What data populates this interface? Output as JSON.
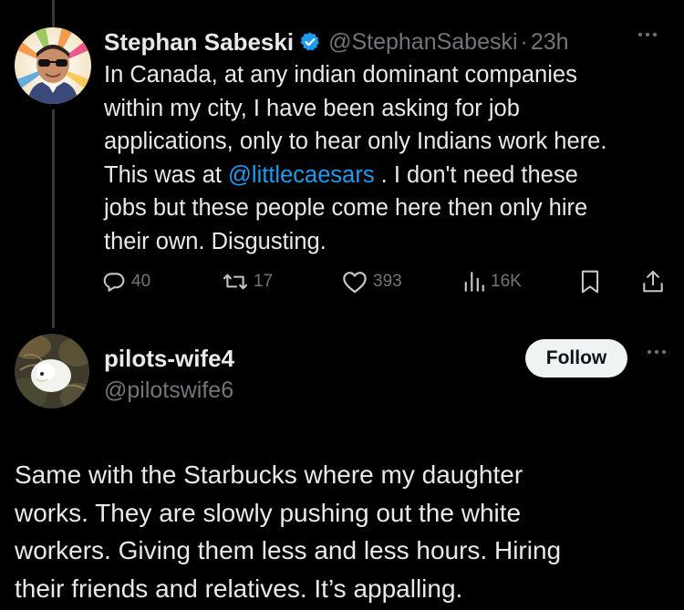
{
  "tweet1": {
    "display_name": "Stephan Sabeski",
    "handle": "@StephanSabeski",
    "separator": "·",
    "time": "23h",
    "body": {
      "line1": "In Canada, at any indian dominant companies",
      "line2": "within my city, I have been asking for job",
      "line3": "applications, only to hear only Indians work here.",
      "line4_pre": "This was at ",
      "mention": "@littlecaesars",
      "line4_post": " . I don't need these",
      "line5": "jobs but these people come here then only hire",
      "line6": "their own. Disgusting."
    },
    "actions": {
      "replies": "40",
      "reposts": "17",
      "likes": "393",
      "views": "16K"
    },
    "icons": [
      "verified-badge-icon",
      "reply-icon",
      "repost-icon",
      "like-icon",
      "views-icon",
      "bookmark-icon",
      "share-icon",
      "more-icon"
    ]
  },
  "tweet2": {
    "display_name": "pilots-wife4",
    "handle": "@pilotswife6",
    "follow_label": "Follow",
    "body": {
      "line1": "Same with the Starbucks where my daughter",
      "line2": "works. They are slowly pushing out the white",
      "line3": "workers. Giving them less and less hours. Hiring",
      "line4": "their friends and relatives. It’s appalling."
    }
  },
  "colors": {
    "background": "#000000",
    "text_primary": "#e7e9ea",
    "text_secondary": "#71767b",
    "accent_link": "#1d9bf0",
    "follow_button_bg": "#eff3f4"
  }
}
